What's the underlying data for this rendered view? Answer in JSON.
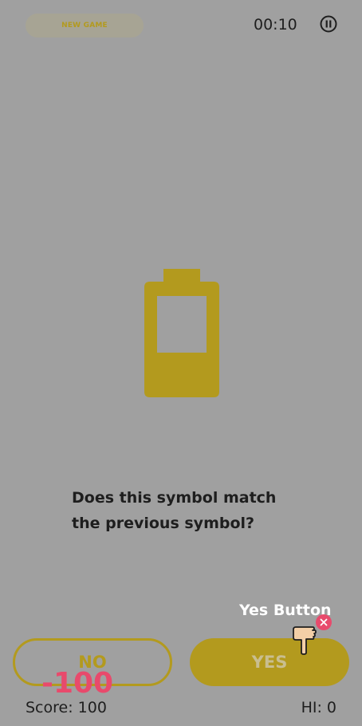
{
  "header": {
    "new_game_label": "NEW GAME",
    "timer": "00:10",
    "pause_icon": "pause-icon"
  },
  "main": {
    "symbol_icon": "battery-icon",
    "question_line1": "Does this symbol match",
    "question_line2": "the previous symbol?"
  },
  "tutorial": {
    "hint_label": "Yes Button",
    "close_icon": "close-icon",
    "hand_icon": "pointing-hand-icon"
  },
  "controls": {
    "no_label": "NO",
    "yes_label": "YES"
  },
  "feedback": {
    "penalty": "-100"
  },
  "footer": {
    "score_label": "Score: 100",
    "hi_label": "HI: 0"
  },
  "colors": {
    "background": "#a0a0a0",
    "accent": "#b39a1e",
    "penalty": "#e84a6c",
    "text": "#1e1e1e"
  }
}
